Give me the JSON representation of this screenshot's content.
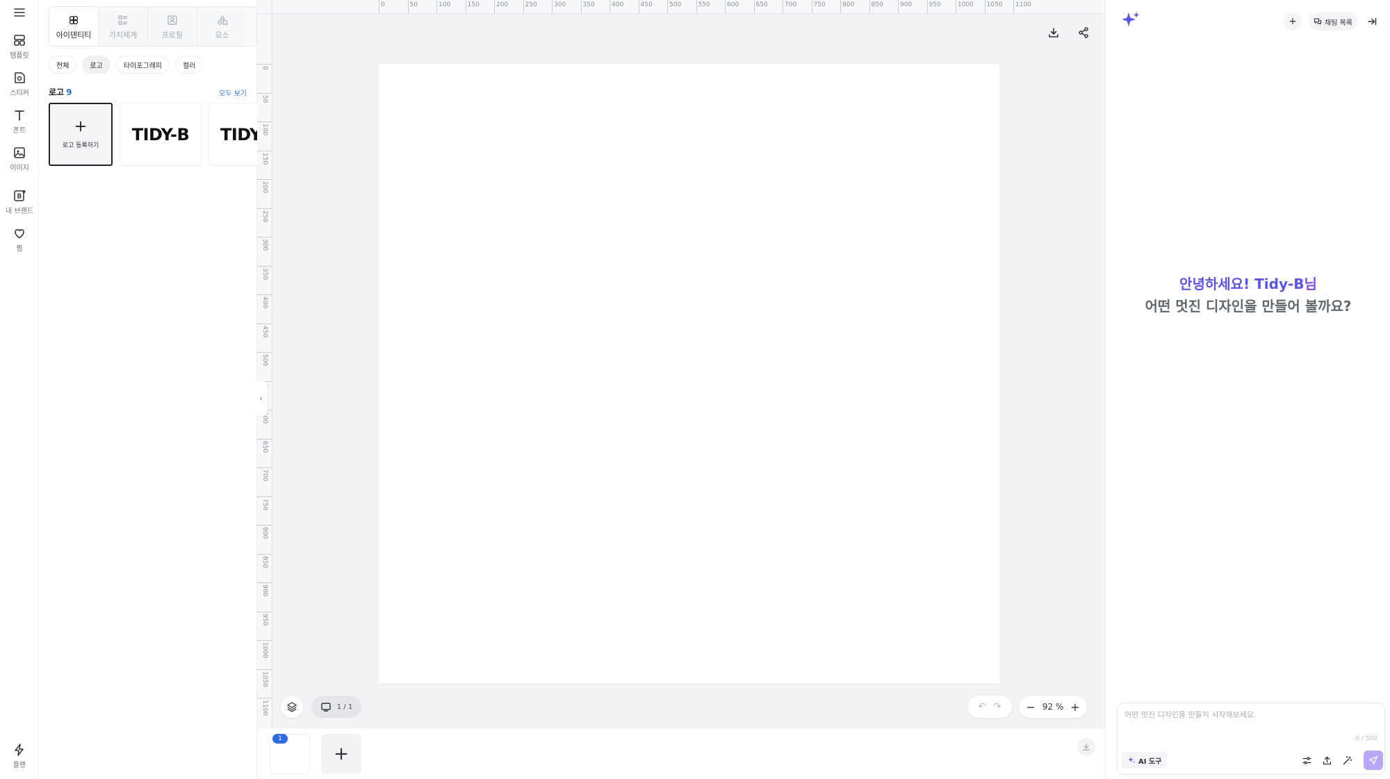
{
  "rail": {
    "items": [
      {
        "label": "템플릿",
        "icon": "template-icon"
      },
      {
        "label": "스티커",
        "icon": "sticker-icon"
      },
      {
        "label": "폰트",
        "icon": "font-icon"
      },
      {
        "label": "이미지",
        "icon": "image-icon"
      },
      {
        "label": "내 브랜드",
        "icon": "brand-icon"
      },
      {
        "label": "찜",
        "icon": "heart-icon"
      }
    ],
    "bottom": {
      "label": "플랜",
      "icon": "lightning-icon"
    }
  },
  "panel": {
    "tabs": [
      {
        "label": "아이덴티티",
        "active": true
      },
      {
        "label": "가치체계",
        "active": false
      },
      {
        "label": "프로필",
        "active": false
      },
      {
        "label": "요소",
        "active": false
      }
    ],
    "chips": [
      {
        "label": "전체",
        "active": false
      },
      {
        "label": "로고",
        "active": true
      },
      {
        "label": "타이포그래피",
        "active": false
      },
      {
        "label": "컬러",
        "active": false
      }
    ],
    "section": {
      "title": "로고",
      "count": "9",
      "see_all": "모두 보기"
    },
    "add_logo_label": "로고 등록하기",
    "logos": [
      "TIDY-B",
      "TIDY"
    ]
  },
  "ruler": {
    "top": [
      "0",
      "50",
      "100",
      "150",
      "200",
      "250",
      "300",
      "350",
      "400",
      "450",
      "500",
      "550",
      "600",
      "650",
      "700",
      "750",
      "800",
      "850",
      "900",
      "950",
      "1000",
      "1050",
      "1100"
    ],
    "left": [
      "0",
      "50",
      "100",
      "150",
      "200",
      "250",
      "300",
      "350",
      "400",
      "450",
      "500",
      "550",
      "600",
      "650",
      "700",
      "750",
      "800",
      "850",
      "900",
      "950",
      "1000",
      "1050",
      "1100"
    ]
  },
  "canvas": {
    "page_indicator": "1 / 1",
    "zoom_value": "92",
    "zoom_unit": "%",
    "undo": "↶",
    "redo": "↷"
  },
  "pagestrip": {
    "page_number": "1"
  },
  "chat": {
    "list_label": "채팅 목록",
    "greeting_name": "안녕하세요! Tidy-B",
    "greeting_suffix": "님",
    "greeting_line2": "어떤 멋진 디자인을 만들어 볼까요?",
    "placeholder": "어떤 멋진 디자인을 만들지 시작해보세요.",
    "char_count": "0 / 500",
    "ai_tool_label": "AI 도구"
  },
  "colors": {
    "accent": "#5b54e8",
    "link": "#2f6be6",
    "send": "#b9a8f5"
  }
}
